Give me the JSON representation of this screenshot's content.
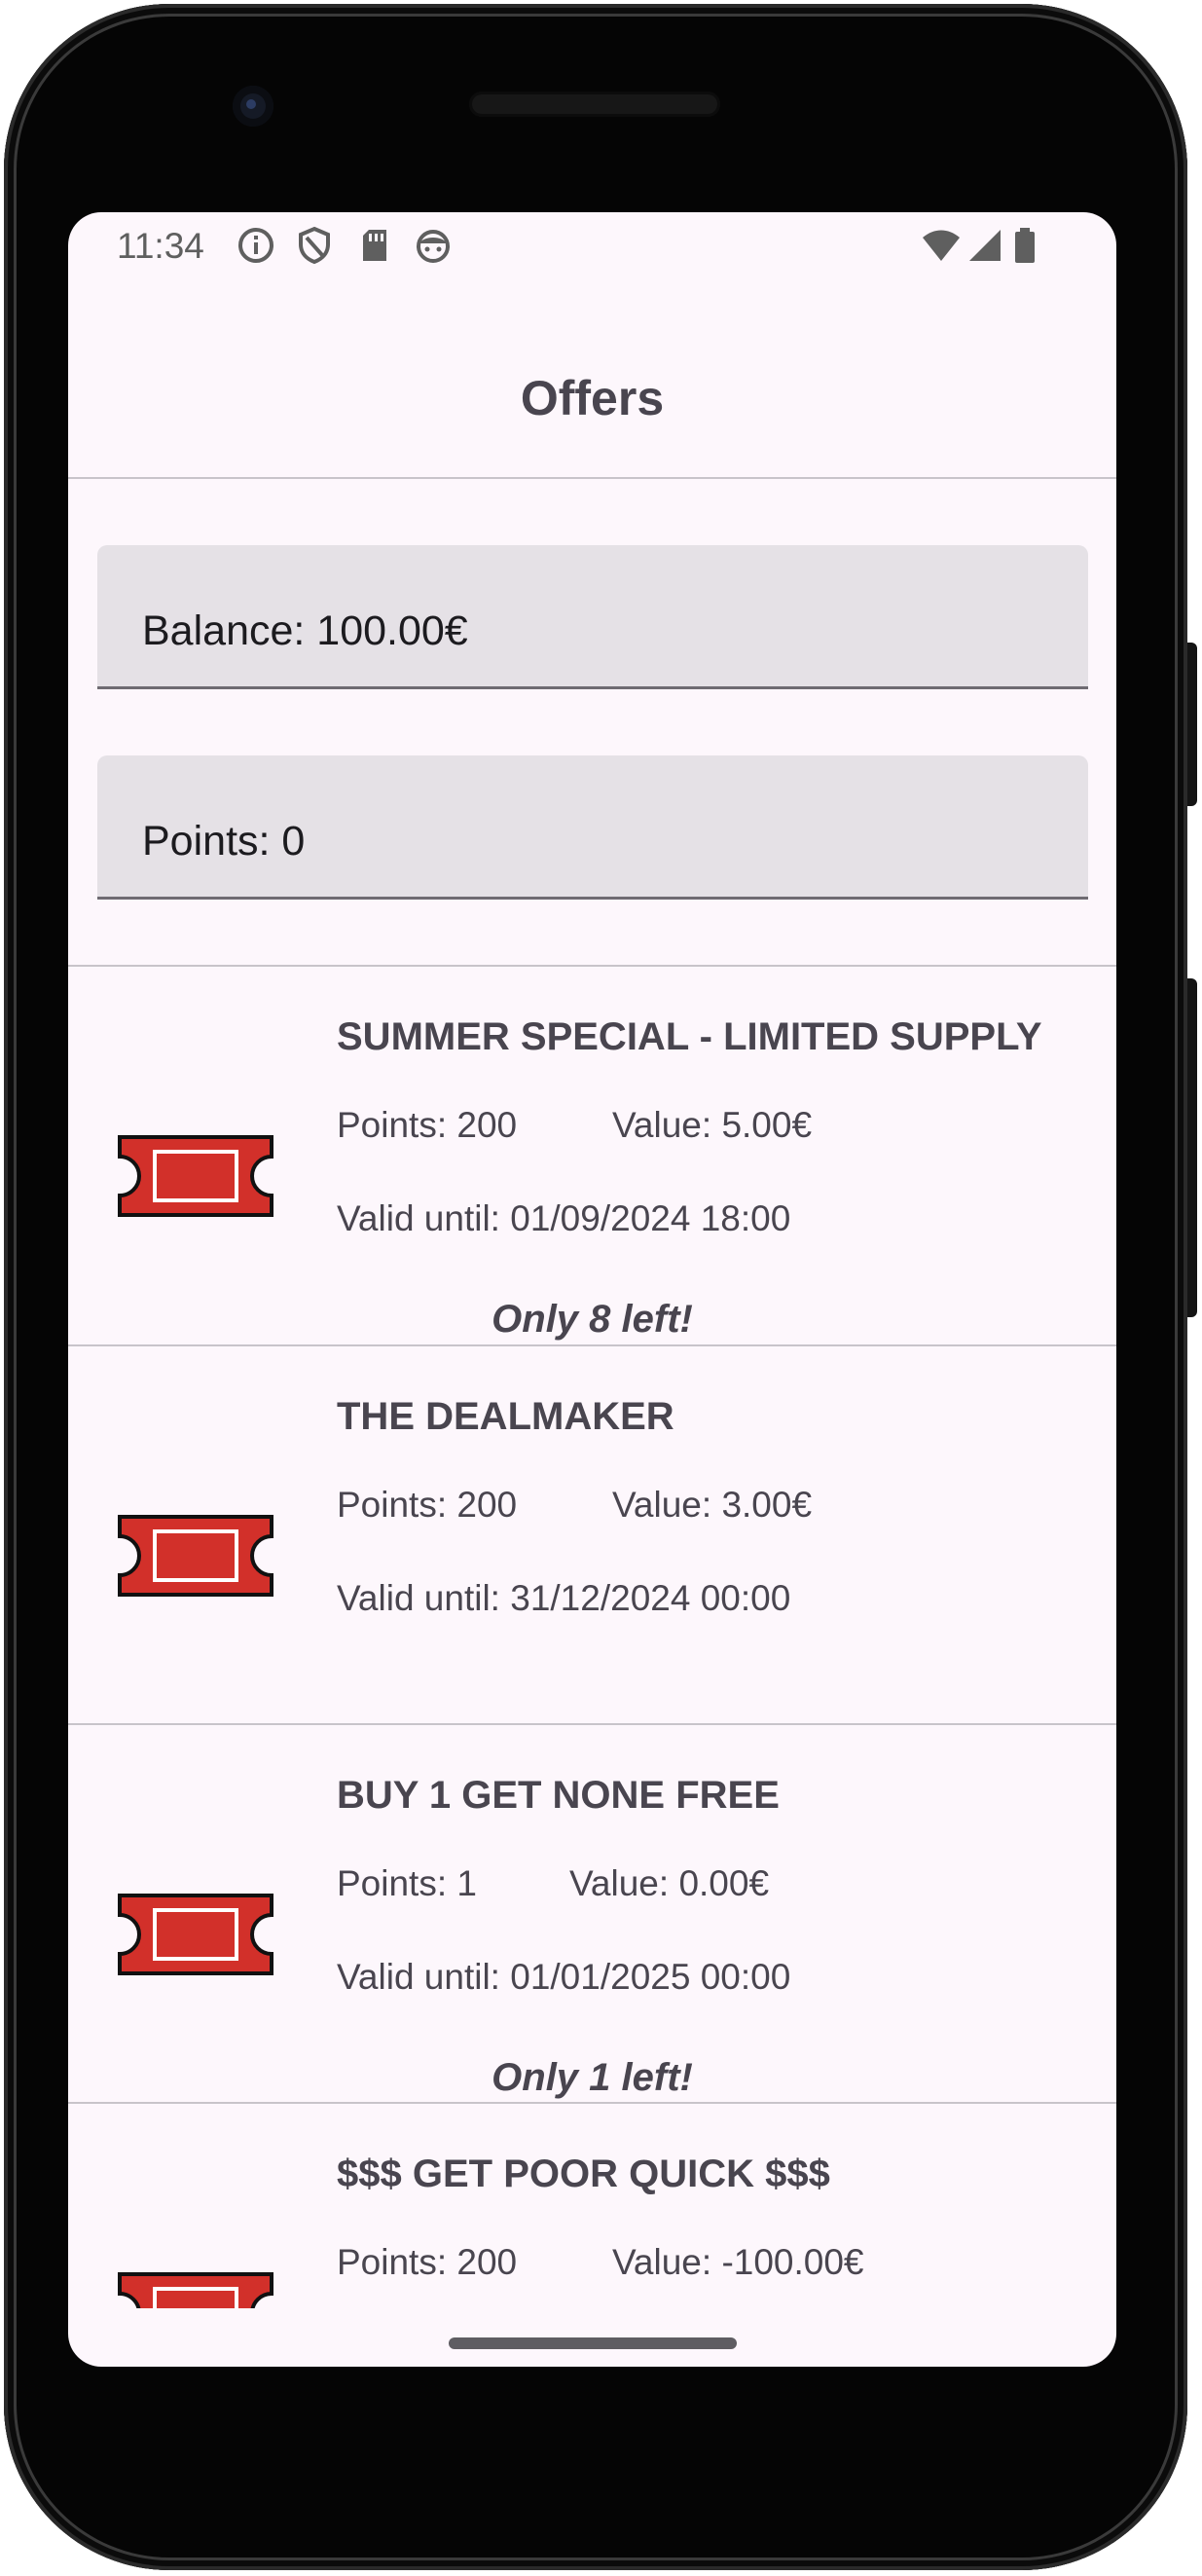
{
  "status_bar": {
    "time": "11:34",
    "left_icons": [
      "info-icon",
      "shield-icon",
      "sd-card-icon",
      "android-face-icon"
    ],
    "right_icons": [
      "wifi-icon",
      "cellular-signal-icon",
      "battery-icon"
    ]
  },
  "app_bar": {
    "title": "Offers"
  },
  "balance": {
    "text": "Balance: 100.00€"
  },
  "points": {
    "text": "Points: 0"
  },
  "colors": {
    "ticket_red": "#d2302a",
    "accent_text": "#49454f",
    "background": "#fdf7fc"
  },
  "offers": [
    {
      "title": "SUMMER SPECIAL - LIMITED SUPPLY",
      "points": "Points: 200",
      "value": "Value: 5.00€",
      "valid_until": "Valid until: 01/09/2024 18:00",
      "stock": "Only 8 left!",
      "icon": "ticket-icon"
    },
    {
      "title": "THE DEALMAKER",
      "points": "Points: 200",
      "value": "Value: 3.00€",
      "valid_until": "Valid until: 31/12/2024 00:00",
      "stock": "",
      "icon": "ticket-icon"
    },
    {
      "title": "BUY 1 GET NONE FREE",
      "points": "Points: 1",
      "value": "Value: 0.00€",
      "valid_until": "Valid until: 01/01/2025 00:00",
      "stock": "Only 1 left!",
      "icon": "ticket-icon"
    },
    {
      "title": "$$$ GET POOR QUICK $$$",
      "points": "Points: 200",
      "value": "Value: -100.00€",
      "valid_until": "",
      "stock": "",
      "icon": "ticket-icon"
    }
  ]
}
